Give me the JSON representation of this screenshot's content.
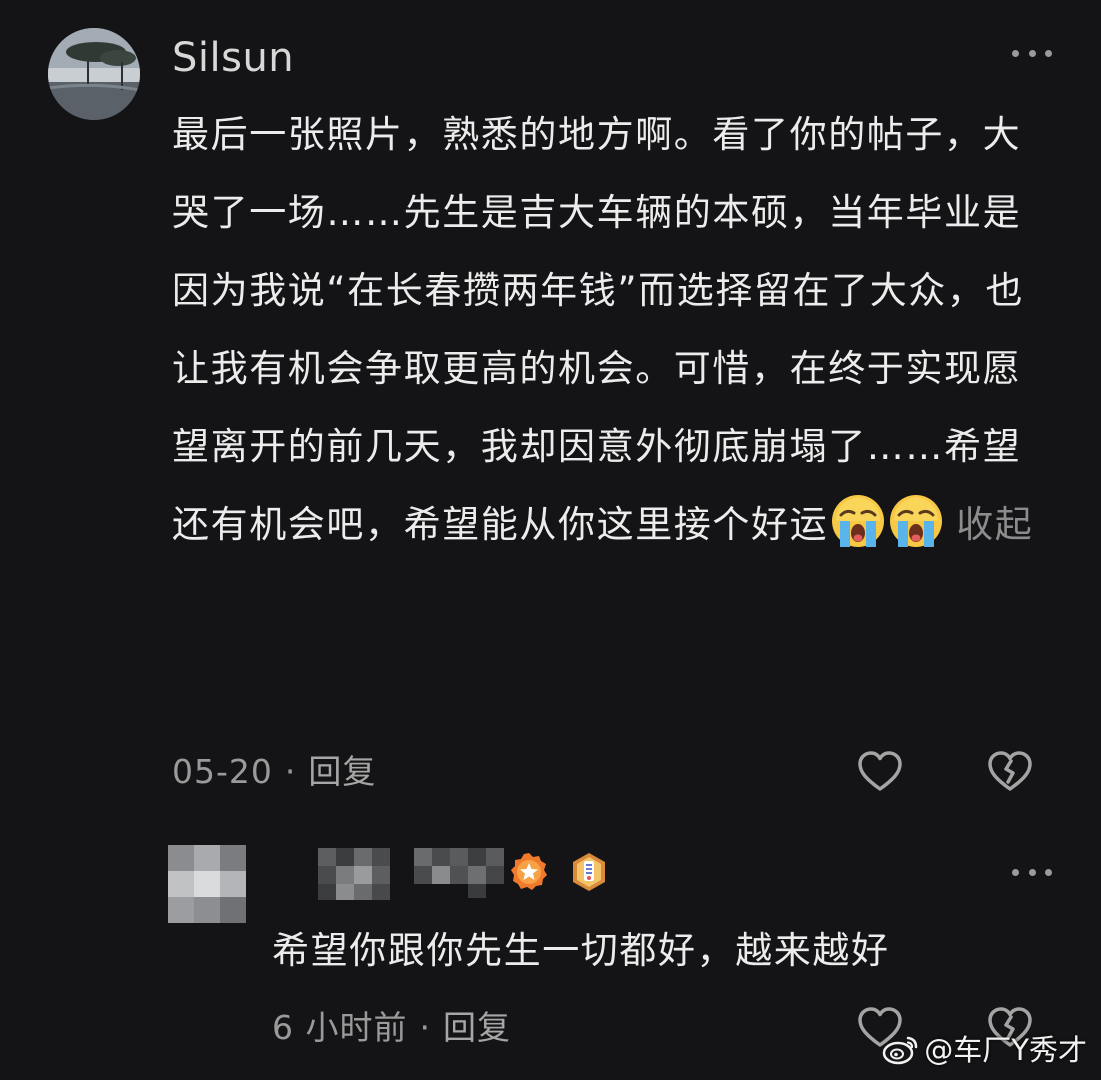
{
  "comment": {
    "username": "Silsun",
    "text": "最后一张照片，熟悉的地方啊。看了你的帖子，大哭了一场……先生是吉大车辆的本硕，当年毕业是因为我说“在长春攒两年钱”而选择留在了大众，也让我有机会争取更高的机会。可惜，在终于实现愿望离开的前几天，我却因意外彻底崩塌了……希望还有机会吧，希望能从你这里接个好运",
    "emojis": [
      "loudly-crying-face",
      "loudly-crying-face"
    ],
    "collapse_label": "收起",
    "date": "05-20",
    "separator": "·",
    "reply_label": "回复"
  },
  "reply": {
    "text": "希望你跟你先生一切都好，越来越好",
    "time": "6 小时前",
    "separator": "·",
    "reply_label": "回复",
    "badges": [
      "orange-star-badge",
      "medal-badge"
    ]
  },
  "icons": {
    "like": "heart-outline-icon",
    "dislike": "broken-heart-icon",
    "more": "more-dots-icon"
  },
  "watermark": {
    "text": "@车厂Y秀才",
    "logo": "weibo-logo"
  },
  "colors": {
    "background": "#141416",
    "text": "#ececec",
    "muted": "#9a9a9a",
    "badge_orange": "#f07a2c"
  }
}
